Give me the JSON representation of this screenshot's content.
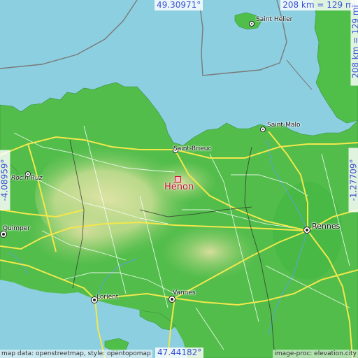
{
  "map": {
    "place": "Hénon",
    "coords": {
      "top": "49.30971°",
      "bottom": "47.44182°",
      "left": "-4.08959°",
      "right": "-1.27709°"
    },
    "scale": "208 km = 129 mi",
    "labels": {
      "saint_helier": "Saint Helier",
      "saint_malo": "Saint-Malo",
      "saint_brieuc": "Saint-Brieuc",
      "roch_ruz": "Roc'h Ruz",
      "rennes": "Rennes",
      "quimper": "Quimper",
      "lorient": "Lorient",
      "vannes": "Vannes"
    },
    "attribution_left": "map data: openstreetmap, style: opentopomap",
    "attribution_right": "image-proc: elevation.city",
    "colors": {
      "sea": "#8ccfe0",
      "land_low": "#4fbf4a",
      "land_mid": "#93cf70",
      "land_high": "#d8dfa0",
      "road": "#f2e84c",
      "border": "#7a7a7a",
      "marker": "#c8102e",
      "text_accent": "#3b4fd6"
    }
  }
}
